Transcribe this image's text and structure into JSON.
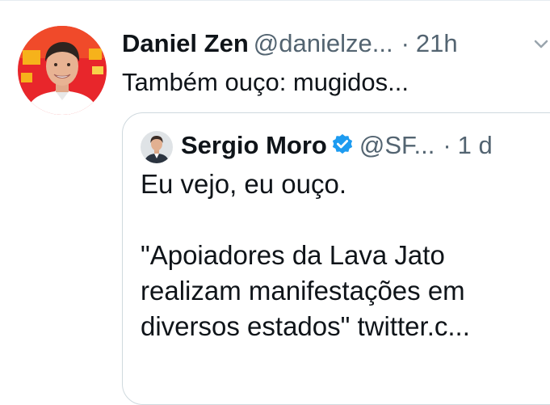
{
  "tweet": {
    "author_name": "Daniel Zen",
    "author_handle": "@danielze...",
    "separator": "·",
    "time": "21h",
    "text": "Também ouço: mugidos...",
    "avatar_icon": "person-photo-avatar"
  },
  "quoted_tweet": {
    "author_name": "Sergio Moro",
    "verified_icon": "verified-badge-icon",
    "author_handle": "@SF...",
    "separator": "·",
    "time": "1 d",
    "text_line_1": "Eu vejo, eu ouço.",
    "text_line_2": "\"Apoiadores da Lava Jato",
    "text_line_3": "realizam manifestações em",
    "text_line_4": "diversos estados\"  twitter.c..."
  },
  "colors": {
    "text_primary": "#0f1419",
    "text_secondary": "#536471",
    "border": "#cfd9de",
    "verified": "#1d9bf0",
    "avatar_background": "#e8262b"
  }
}
